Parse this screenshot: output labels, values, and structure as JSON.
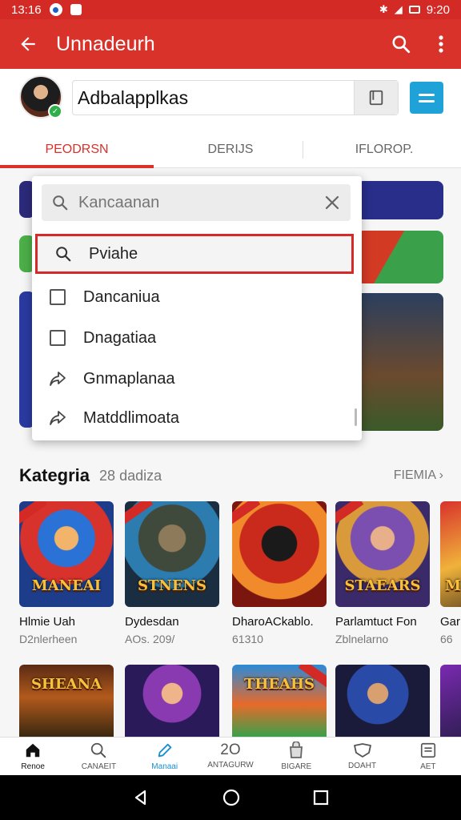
{
  "status": {
    "time": "13:16",
    "clock": "9:20"
  },
  "header": {
    "title": "Unnadeurh"
  },
  "profile": {
    "name": "Adbalapplkas"
  },
  "tabs": [
    {
      "label": "PEODRSN"
    },
    {
      "label": "DERIJS"
    },
    {
      "label": "IFLOROP."
    }
  ],
  "dropdown": {
    "search_placeholder": "Kancaanan",
    "items": [
      {
        "label": "Pviahe",
        "icon": "search-icon"
      },
      {
        "label": "Dancaniua",
        "icon": "checkbox-icon"
      },
      {
        "label": "Dnagatiaa",
        "icon": "checkbox-icon"
      },
      {
        "label": "Gnmaplanaa",
        "icon": "share-icon"
      },
      {
        "label": "Matddlimoata",
        "icon": "share-icon"
      }
    ]
  },
  "section": {
    "title": "Kategria",
    "count": "28 dadiza",
    "more": "FIEMIA"
  },
  "games_row1": [
    {
      "title": "Hlmie Uah",
      "sub": "D2nlerheen",
      "art": "MANEAI"
    },
    {
      "title": "Dydesdan",
      "sub": "AOs. 209/",
      "art": "STNENS"
    },
    {
      "title": "DharoACkablo.",
      "sub": "61310",
      "art": ""
    },
    {
      "title": "Parlamtuct Fon",
      "sub": "Zblnelarno",
      "art": "STAEARS"
    },
    {
      "title": "Gar",
      "sub": "66",
      "art": "M"
    }
  ],
  "games_row2": [
    {
      "art": "SHEANA"
    },
    {
      "art": ""
    },
    {
      "art": "THEAHS"
    },
    {
      "art": ""
    },
    {
      "art": ""
    }
  ],
  "nav": [
    {
      "label": "Renoe"
    },
    {
      "label": "CANAEIT"
    },
    {
      "label": "Manaai"
    },
    {
      "label": "ANTAGURW"
    },
    {
      "label": "BIGARE"
    },
    {
      "label": "DOAHT"
    },
    {
      "label": "AET"
    }
  ],
  "colors": {
    "brand": "#d9322a",
    "accent": "#1fa2d8",
    "highlight": "#d42a2a"
  }
}
